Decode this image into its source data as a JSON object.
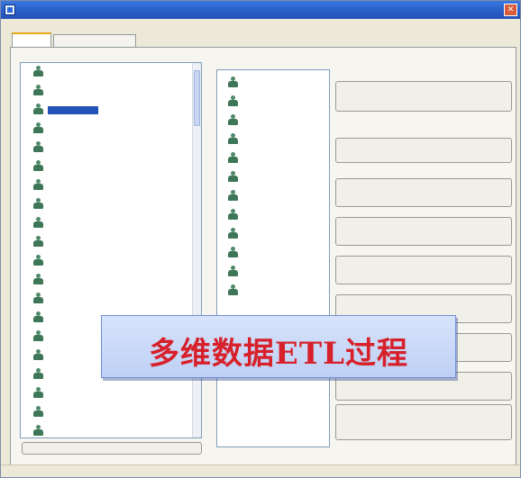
{
  "window": {
    "title": ""
  },
  "menu": [
    {
      "label": ""
    },
    {
      "label": ""
    },
    {
      "label": ""
    },
    {
      "label": ""
    },
    {
      "label": ""
    },
    {
      "label": ""
    }
  ],
  "tabs": [
    {
      "label": ""
    },
    {
      "label": ""
    }
  ],
  "left_panel": {
    "label": "",
    "items": [
      {
        "label": ""
      },
      {
        "label": ""
      },
      {
        "label": ""
      },
      {
        "label": ""
      },
      {
        "label": ""
      },
      {
        "label": ""
      },
      {
        "label": ""
      },
      {
        "label": ""
      },
      {
        "label": ""
      },
      {
        "label": ""
      },
      {
        "label": ""
      },
      {
        "label": ""
      },
      {
        "label": ""
      },
      {
        "label": ""
      },
      {
        "label": ""
      },
      {
        "label": ""
      },
      {
        "label": ""
      },
      {
        "label": ""
      },
      {
        "label": ""
      },
      {
        "label": ""
      }
    ],
    "button_label": ""
  },
  "middle_panel": {
    "label": "",
    "sublabel": "",
    "items": [
      {
        "label": ""
      },
      {
        "label": ""
      },
      {
        "label": ""
      },
      {
        "label": ""
      },
      {
        "label": ""
      },
      {
        "label": ""
      },
      {
        "label": ""
      },
      {
        "label": ""
      },
      {
        "label": ""
      },
      {
        "label": ""
      },
      {
        "label": ""
      },
      {
        "label": ""
      }
    ]
  },
  "right_panel": {
    "group1_title": "",
    "group1_subtitle": "",
    "group1_button": "",
    "group2_title": "",
    "group2_subtitle": "",
    "group2_button": "",
    "group3_title": "",
    "group3_buttons": [
      {
        "label": ""
      },
      {
        "label": ""
      },
      {
        "label": ""
      },
      {
        "label": ""
      },
      {
        "label": ""
      },
      {
        "label": ""
      },
      {
        "label": ""
      }
    ]
  },
  "status": {
    "text": ""
  },
  "overlay": {
    "text": "多维数据ETL过程"
  }
}
